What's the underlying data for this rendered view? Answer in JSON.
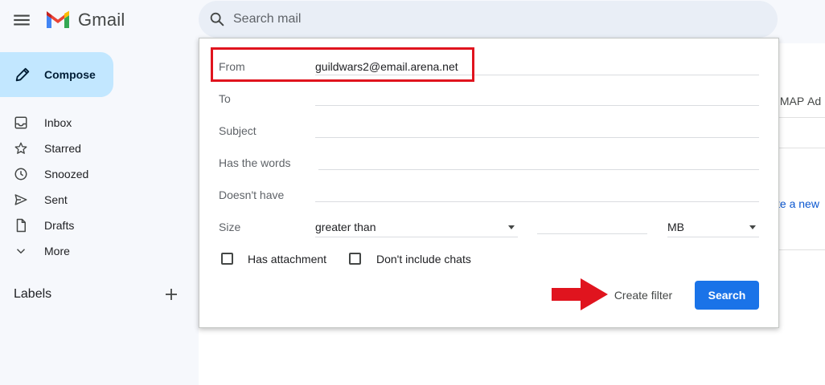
{
  "header": {
    "brand": "Gmail",
    "search_placeholder": "Search mail"
  },
  "compose": {
    "label": "Compose"
  },
  "nav": {
    "items": [
      {
        "label": "Inbox",
        "icon": "inbox-icon"
      },
      {
        "label": "Starred",
        "icon": "star-icon"
      },
      {
        "label": "Snoozed",
        "icon": "clock-icon"
      },
      {
        "label": "Sent",
        "icon": "send-icon"
      },
      {
        "label": "Drafts",
        "icon": "file-icon"
      },
      {
        "label": "More",
        "icon": "chevron-down-icon"
      }
    ]
  },
  "labels": {
    "title": "Labels"
  },
  "background": {
    "imap_text": "IMAP",
    "ad_text": "Ad",
    "link_text": "te a new"
  },
  "advanced_search": {
    "from_label": "From",
    "from_value": "guildwars2@email.arena.net",
    "to_label": "To",
    "to_value": "",
    "subject_label": "Subject",
    "subject_value": "",
    "has_words_label": "Has the words",
    "has_words_value": "",
    "doesnt_have_label": "Doesn't have",
    "doesnt_have_value": "",
    "size_label": "Size",
    "size_comparator": "greater than",
    "size_value": "",
    "size_unit": "MB",
    "has_attachment_label": "Has attachment",
    "has_attachment_checked": false,
    "dont_include_chats_label": "Don't include chats",
    "dont_include_chats_checked": false,
    "create_filter_label": "Create filter",
    "search_label": "Search"
  },
  "colors": {
    "accent": "#1a73e8",
    "compose_bg": "#c2e7ff",
    "highlight": "#e0141e",
    "annotation_arrow": "#e0141e"
  }
}
